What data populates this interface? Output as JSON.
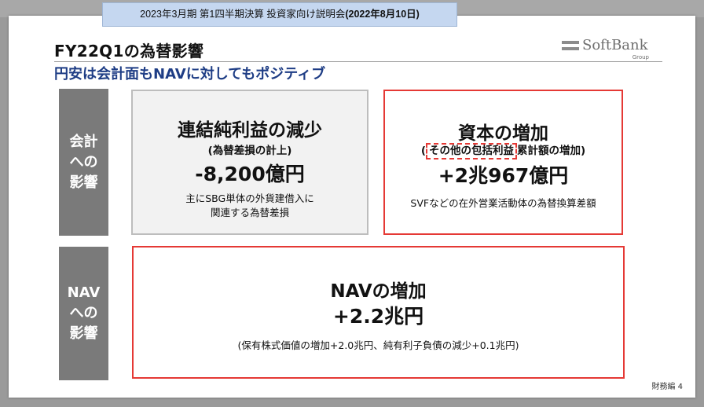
{
  "session": {
    "prefix": "2023年3月期 第1四半期決算 投資家向け説明会",
    "date": "(2022年8月10日)"
  },
  "slide": {
    "title": "FY22Q1の為替影響",
    "subtitle": "円安は会計面もNAVに対してもポジティブ",
    "logo": {
      "name": "SoftBank",
      "sub": "Group"
    },
    "side_labels": {
      "accounting": [
        "会計",
        "への",
        "影響"
      ],
      "nav": [
        "NAV",
        "への",
        "影響"
      ]
    },
    "box_net_income": {
      "heading": "連結純利益の減少",
      "sub": "(為替差損の計上)",
      "amount": "-8,200億円",
      "note_line1": "主にSBG単体の外貨建借入に",
      "note_line2": "関連する為替差損"
    },
    "box_equity": {
      "heading": "資本の増加",
      "sub_open": "(",
      "sub_highlight": "その他の包括利益",
      "sub_rest": "累計額の増加)",
      "amount": "+2兆967億円",
      "note": "SVFなどの在外営業活動体の為替換算差額"
    },
    "box_nav": {
      "heading": "NAVの増加",
      "amount": "+2.2兆円",
      "note": "(保有株式価値の増加+2.0兆円、純有利子負債の減少+0.1兆円)"
    },
    "page_label": "財務編 4"
  },
  "colors": {
    "accent_blue": "#1e3d85",
    "highlight_red": "#e53935",
    "label_gray": "#7a7a7a",
    "session_bg": "#c5d7f0"
  }
}
